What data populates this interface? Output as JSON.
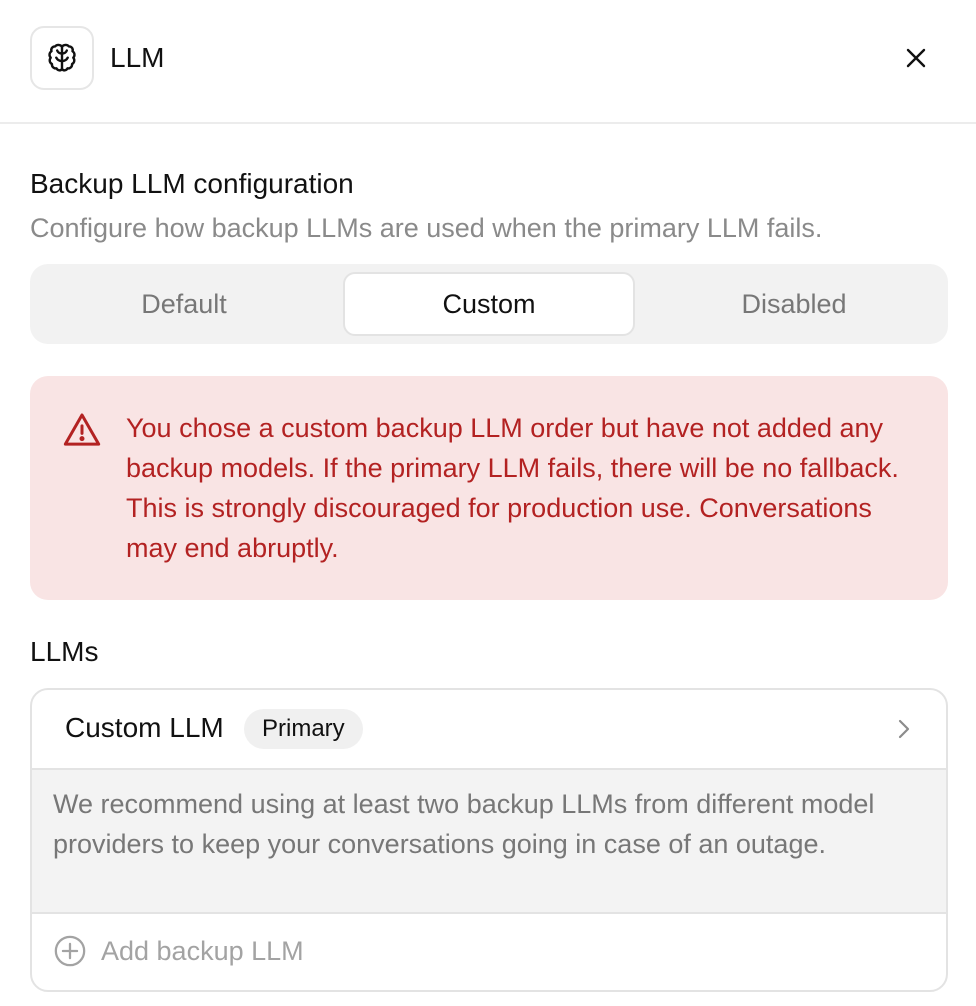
{
  "header": {
    "app_icon": "brain-icon",
    "title": "LLM",
    "close_icon": "close-icon"
  },
  "backup": {
    "title": "Backup LLM configuration",
    "description": "Configure how backup LLMs are used when the primary LLM fails.",
    "options": [
      "Default",
      "Custom",
      "Disabled"
    ],
    "selected": "Custom"
  },
  "alert": {
    "icon": "warning-triangle-icon",
    "color": "#b32222",
    "background": "#f9e4e4",
    "text": "You chose a custom backup LLM order but have not added any backup models. If the primary LLM fails, there will be no fallback. This is strongly discouraged for production use. Conversations may end abruptly."
  },
  "llms": {
    "label": "LLMs",
    "items": [
      {
        "name": "Custom LLM",
        "badge": "Primary",
        "icon": "chevron-right-icon"
      }
    ],
    "recommendation": "We recommend using at least two backup LLMs from different model providers to keep your conversations going in case of an outage.",
    "add_label": "Add backup LLM",
    "add_icon": "plus-circle-icon"
  }
}
